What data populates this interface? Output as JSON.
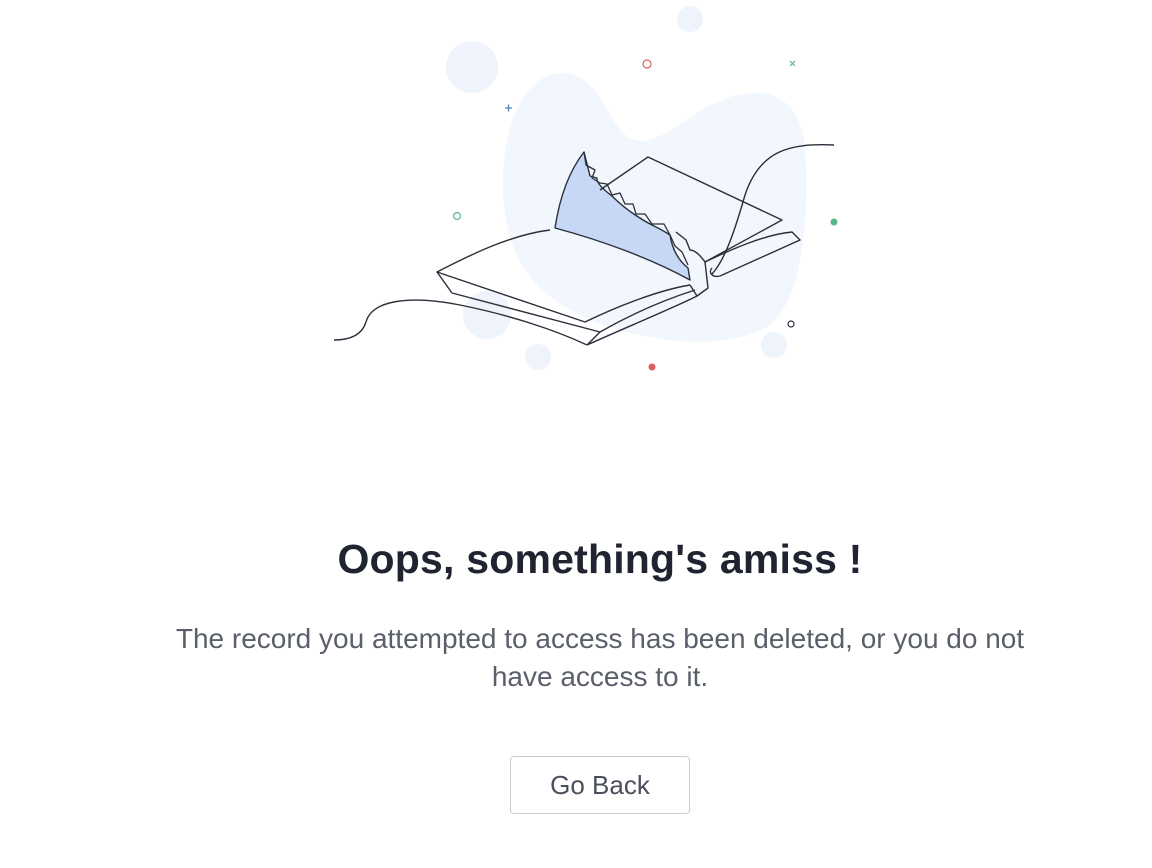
{
  "error": {
    "title": "Oops, something's amiss !",
    "message": "The record you attempted to access has been deleted, or you do not have access to it.",
    "go_back_label": "Go Back"
  },
  "colors": {
    "title": "#1f2430",
    "message": "#5a5f6b",
    "blob": "#f2f6fd",
    "page_fill": "#c7d7f6"
  }
}
